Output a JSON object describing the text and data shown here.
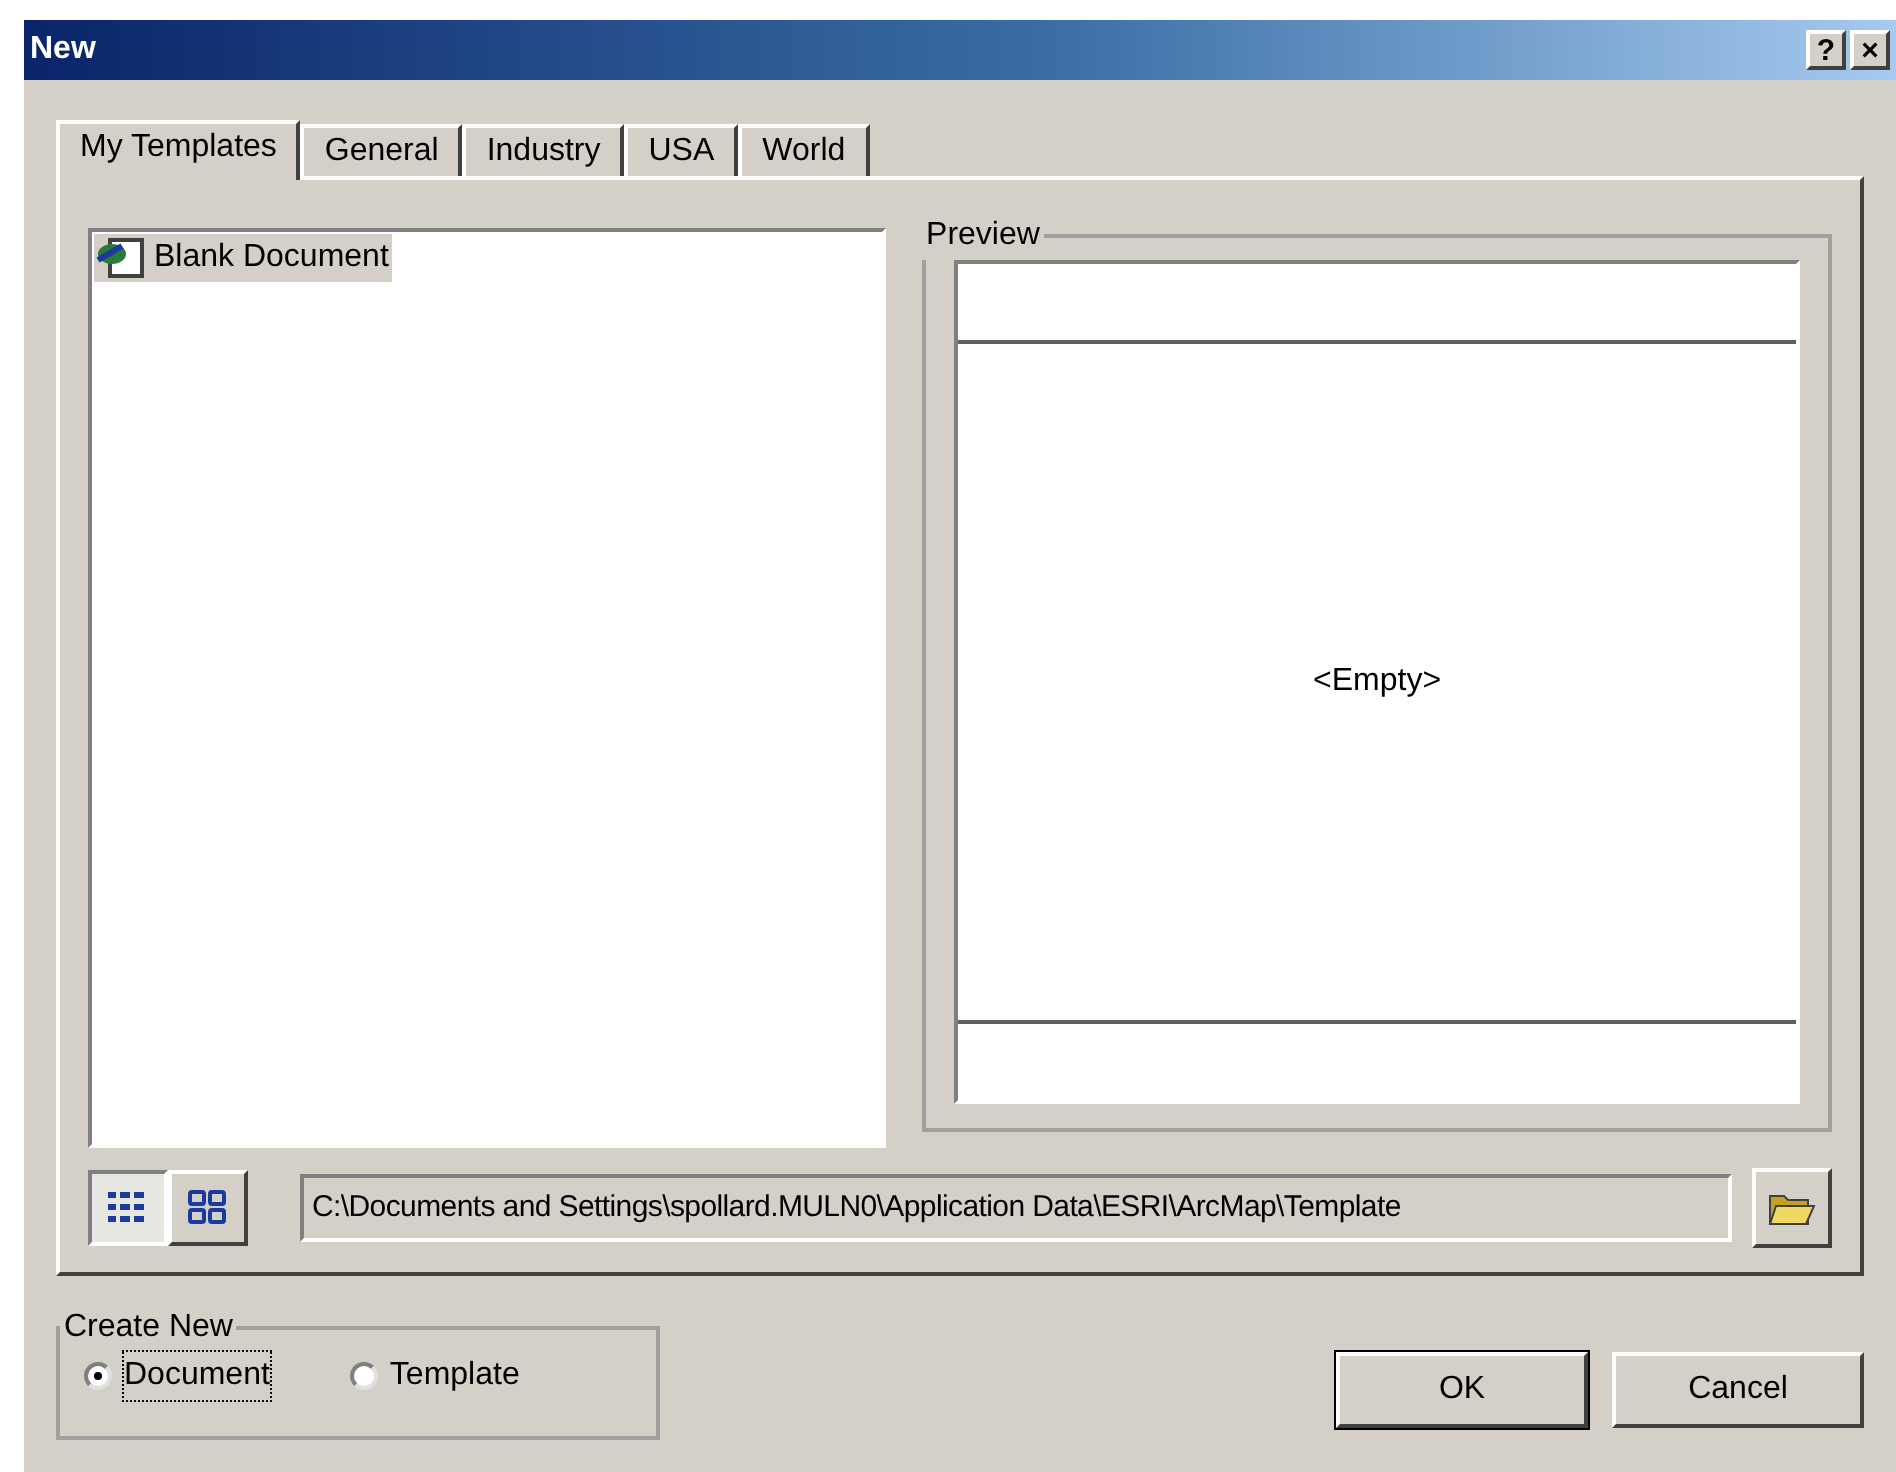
{
  "window": {
    "title": "New",
    "title_buttons": [
      "?",
      "×"
    ]
  },
  "tabs": [
    {
      "label": "My Templates",
      "selected": true
    },
    {
      "label": "General",
      "selected": false
    },
    {
      "label": "Industry",
      "selected": false
    },
    {
      "label": "USA",
      "selected": false
    },
    {
      "label": "World",
      "selected": false
    }
  ],
  "templates": [
    {
      "label": "Blank Document",
      "selected": true
    }
  ],
  "preview": {
    "title": "Preview",
    "text": "<Empty>"
  },
  "view_buttons": [
    {
      "kind": "list",
      "selected": true
    },
    {
      "kind": "icons",
      "selected": false
    }
  ],
  "path": "C:\\Documents and Settings\\spollard.MULN0\\Application Data\\ESRI\\ArcMap\\Template",
  "create_new": {
    "title": "Create New",
    "options": [
      {
        "label": "Document",
        "selected": true
      },
      {
        "label": "Template",
        "selected": false
      }
    ]
  },
  "buttons": [
    "OK",
    "Cancel"
  ]
}
